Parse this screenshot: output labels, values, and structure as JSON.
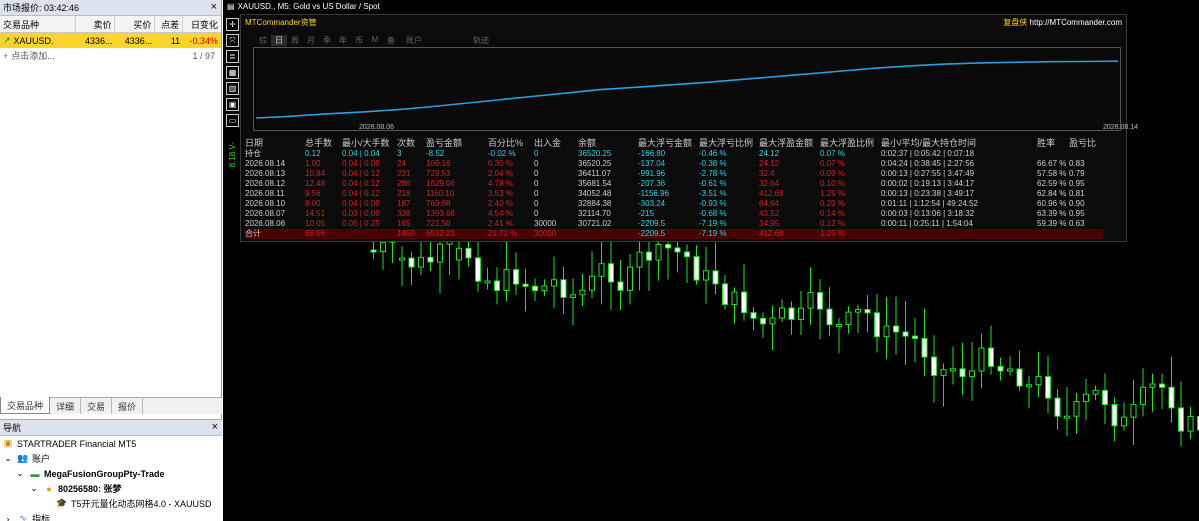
{
  "market_watch": {
    "title": "市场报价: 03:42:46",
    "columns": [
      "交易品种",
      "卖价",
      "买价",
      "点差",
      "日变化"
    ],
    "row": {
      "symbol": "XAUUSD.",
      "bid": "4336...",
      "ask": "4336...",
      "spread": "11",
      "change": "-0.34%"
    },
    "add_label": "点击添加...",
    "count": "1 / 97",
    "tabs": [
      "交易品种",
      "详细",
      "交易",
      "报价"
    ]
  },
  "navigator": {
    "title": "导航",
    "broker": "STARTRADER Financial MT5",
    "accounts": "账户",
    "server": "MegaFusionGroupPty-Trade",
    "account": "80256580: 张梦",
    "ea": "T5开元量化动态网格4.0 - XAUUSD",
    "indicators": "指标"
  },
  "chart": {
    "title": "XAUUSD., M5: Gold vs US Dollar / Spot",
    "side_label": "8.18 V-",
    "toolbar_icons": [
      "cross-icon",
      "move-icon",
      "list-icon",
      "save-icon",
      "grid-icon",
      "calendar-icon",
      "window-icon"
    ]
  },
  "panel": {
    "title": "MTCommander资管",
    "brand_cn": "复盘侠",
    "brand_url": "http://MTCommander.com",
    "tabs": [
      "综",
      "日",
      "周",
      "月",
      "季",
      "年",
      "币",
      "M",
      "备",
      "账户",
      "轨迹"
    ],
    "active_tab": "日",
    "date_start": "2026.08.06",
    "date_end": "2026.08.14",
    "equity_curve": [
      0.0,
      0.03,
      0.07,
      0.1,
      0.14,
      0.19,
      0.25,
      0.31,
      0.37,
      0.43,
      0.49,
      0.53,
      0.57,
      0.61,
      0.66,
      0.71,
      0.76,
      0.81,
      0.86,
      0.9,
      0.93,
      0.95,
      0.96,
      0.97,
      0.975,
      0.98
    ],
    "headers": [
      "日期",
      "总手数",
      "最小/大手数",
      "次数",
      "盈亏金额",
      "百分比%",
      "出入金",
      "余额",
      "最大浮亏金额",
      "最大浮亏比例",
      "最大浮盈金额",
      "最大浮盈比例",
      "最小/平均/最大持仓时间",
      "胜率",
      "盈亏比"
    ],
    "holding": [
      "持仓",
      "0.12",
      "0.04 | 0.04",
      "3",
      "-8.52",
      "-0.02 %",
      "0",
      "36520.25",
      "-166.80",
      "-0.46 %",
      "24.12",
      "0.07 %",
      "0:02:37 | 0:05:42 | 0:07:18",
      "",
      ""
    ],
    "rows": [
      [
        "2026.08.14",
        "1.00",
        "0.04 | 0.08",
        "24",
        "109.16",
        "0.30 %",
        "0",
        "36520.25",
        "-137.04",
        "-0.38 %",
        "24.12",
        "0.07 %",
        "0:04:24 | 0:38:45 | 2:27:56",
        "66.67 %",
        "0.83"
      ],
      [
        "2026.08.13",
        "10.84",
        "0.04 | 0.12",
        "231",
        "729.53",
        "2.04 %",
        "0",
        "36411.07",
        "-991.96",
        "-2.78 %",
        "32.4",
        "0.09 %",
        "0:00:13 | 0:27:55 | 3:47:49",
        "57.58 %",
        "0.79"
      ],
      [
        "2026.08.12",
        "12.48",
        "0.04 | 0.12",
        "286",
        "1629.06",
        "4.78 %",
        "0",
        "35681.54",
        "-207.36",
        "-0.61 %",
        "32.64",
        "0.10 %",
        "0:00:02 | 0:19:13 | 3:44:17",
        "62.59 %",
        "0.95"
      ],
      [
        "2026.08.11",
        "9.56",
        "0.04 | 0.12",
        "218",
        "1160.10",
        "3.53 %",
        "0",
        "34052.48",
        "-1156.96",
        "-3.51 %",
        "412.68",
        "1.25 %",
        "0:00:13 | 0:23:38 | 3:49:17",
        "62.84 %",
        "0.81"
      ],
      [
        "2026.08.10",
        "8.00",
        "0.04 | 0.08",
        "187",
        "769.68",
        "2.40 %",
        "0",
        "32884.38",
        "-303.24",
        "-0.93 %",
        "64.64",
        "0.20 %",
        "0:01:11 | 1:12:54 | 49:24:52",
        "60.96 %",
        "0.90"
      ],
      [
        "2026.08.07",
        "14.51",
        "0.03 | 0.08",
        "338",
        "1393.68",
        "4.54 %",
        "0",
        "32114.70",
        "-215",
        "-0.68 %",
        "43.52",
        "0.14 %",
        "0:00:03 | 0:13:06 | 3:18:32",
        "63.39 %",
        "0.95"
      ],
      [
        "2026.08.06",
        "10.05",
        "0.05 | 0.25",
        "165",
        "721.50",
        "2.41 %",
        "30000",
        "30721.02",
        "-2209.5",
        "-7.19 %",
        "34.95",
        "0.12 %",
        "0:00:11 | 0:25:11 | 1:54:04",
        "59.39 %",
        "0.63"
      ]
    ],
    "total": [
      "合计",
      "66.56",
      "",
      "1450",
      "6512.21",
      "21.71 %",
      "30000",
      "",
      "-2209.5",
      "-7.19 %",
      "412.68",
      "1.25 %",
      "",
      "",
      ""
    ]
  },
  "colors": {
    "bull": "#1de31d",
    "bear": "#ffffff",
    "accent": "#ffd200",
    "cyan": "#2ad5e6",
    "red": "#cc2222",
    "highlight": "#ffd42a"
  }
}
